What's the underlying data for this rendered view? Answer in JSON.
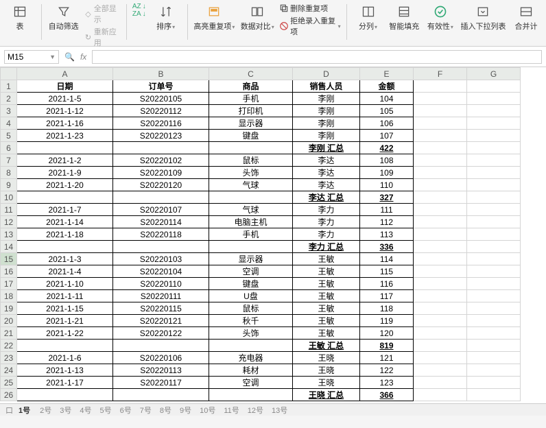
{
  "ribbon": {
    "filter": "自动筛选",
    "showall": "全部显示",
    "reapply": "重新应用",
    "za": "ZA",
    "az": "AZ",
    "sort": "排序",
    "highlight": "高亮重复项",
    "compare": "数据对比",
    "removedup": "删除重复项",
    "rejectdup": "拒绝录入重复项",
    "split": "分列",
    "smartfill": "智能填充",
    "validity": "有效性",
    "dropdown": "插入下拉列表",
    "merge": "合并计"
  },
  "cellref": "M15",
  "cols": [
    "A",
    "B",
    "C",
    "D",
    "E",
    "F",
    "G"
  ],
  "colw": [
    "cA",
    "cB",
    "cC",
    "cD",
    "cE",
    "cF",
    "cG"
  ],
  "sheets": {
    "active": "1号",
    "others": [
      "2号",
      "3号",
      "4号",
      "5号",
      "6号",
      "7号",
      "8号",
      "9号",
      "10号",
      "11号",
      "12号",
      "13号"
    ]
  },
  "header": {
    "a": "日期",
    "b": "订单号",
    "c": "商品",
    "d": "销售人员",
    "e": "金额"
  },
  "rows": [
    {
      "n": 1,
      "a": "日期",
      "b": "订单号",
      "c": "商品",
      "d": "销售人员",
      "e": "金额",
      "hdr": true
    },
    {
      "n": 2,
      "a": "2021-1-5",
      "b": "S20220105",
      "c": "手机",
      "d": "李刚",
      "e": "104"
    },
    {
      "n": 3,
      "a": "2021-1-12",
      "b": "S20220112",
      "c": "打印机",
      "d": "李刚",
      "e": "105"
    },
    {
      "n": 4,
      "a": "2021-1-16",
      "b": "S20220116",
      "c": "显示器",
      "d": "李刚",
      "e": "106"
    },
    {
      "n": 5,
      "a": "2021-1-23",
      "b": "S20220123",
      "c": "键盘",
      "d": "李刚",
      "e": "107"
    },
    {
      "n": 6,
      "a": "",
      "b": "",
      "c": "",
      "d": "李刚 汇总",
      "e": "422",
      "sub": true
    },
    {
      "n": 7,
      "a": "2021-1-2",
      "b": "S20220102",
      "c": "鼠标",
      "d": "李达",
      "e": "108"
    },
    {
      "n": 8,
      "a": "2021-1-9",
      "b": "S20220109",
      "c": "头饰",
      "d": "李达",
      "e": "109"
    },
    {
      "n": 9,
      "a": "2021-1-20",
      "b": "S20220120",
      "c": "气球",
      "d": "李达",
      "e": "110"
    },
    {
      "n": 10,
      "a": "",
      "b": "",
      "c": "",
      "d": "李达 汇总",
      "e": "327",
      "sub": true
    },
    {
      "n": 11,
      "a": "2021-1-7",
      "b": "S20220107",
      "c": "气球",
      "d": "李力",
      "e": "111"
    },
    {
      "n": 12,
      "a": "2021-1-14",
      "b": "S20220114",
      "c": "电脑主机",
      "d": "李力",
      "e": "112"
    },
    {
      "n": 13,
      "a": "2021-1-18",
      "b": "S20220118",
      "c": "手机",
      "d": "李力",
      "e": "113"
    },
    {
      "n": 14,
      "a": "",
      "b": "",
      "c": "",
      "d": "李力 汇总",
      "e": "336",
      "sub": true
    },
    {
      "n": 15,
      "a": "2021-1-3",
      "b": "S20220103",
      "c": "显示器",
      "d": "王敏",
      "e": "114",
      "sel": true
    },
    {
      "n": 16,
      "a": "2021-1-4",
      "b": "S20220104",
      "c": "空调",
      "d": "王敏",
      "e": "115"
    },
    {
      "n": 17,
      "a": "2021-1-10",
      "b": "S20220110",
      "c": "键盘",
      "d": "王敏",
      "e": "116"
    },
    {
      "n": 18,
      "a": "2021-1-11",
      "b": "S20220111",
      "c": "U盘",
      "d": "王敏",
      "e": "117"
    },
    {
      "n": 19,
      "a": "2021-1-15",
      "b": "S20220115",
      "c": "鼠标",
      "d": "王敏",
      "e": "118"
    },
    {
      "n": 20,
      "a": "2021-1-21",
      "b": "S20220121",
      "c": "秋千",
      "d": "王敏",
      "e": "119"
    },
    {
      "n": 21,
      "a": "2021-1-22",
      "b": "S20220122",
      "c": "头饰",
      "d": "王敏",
      "e": "120"
    },
    {
      "n": 22,
      "a": "",
      "b": "",
      "c": "",
      "d": "王敏 汇总",
      "e": "819",
      "sub": true
    },
    {
      "n": 23,
      "a": "2021-1-6",
      "b": "S20220106",
      "c": "充电器",
      "d": "王晓",
      "e": "121"
    },
    {
      "n": 24,
      "a": "2021-1-13",
      "b": "S20220113",
      "c": "耗材",
      "d": "王晓",
      "e": "122"
    },
    {
      "n": 25,
      "a": "2021-1-17",
      "b": "S20220117",
      "c": "空调",
      "d": "王晓",
      "e": "123"
    },
    {
      "n": 26,
      "a": "",
      "b": "",
      "c": "",
      "d": "王晓 汇总",
      "e": "366",
      "sub": true
    }
  ]
}
